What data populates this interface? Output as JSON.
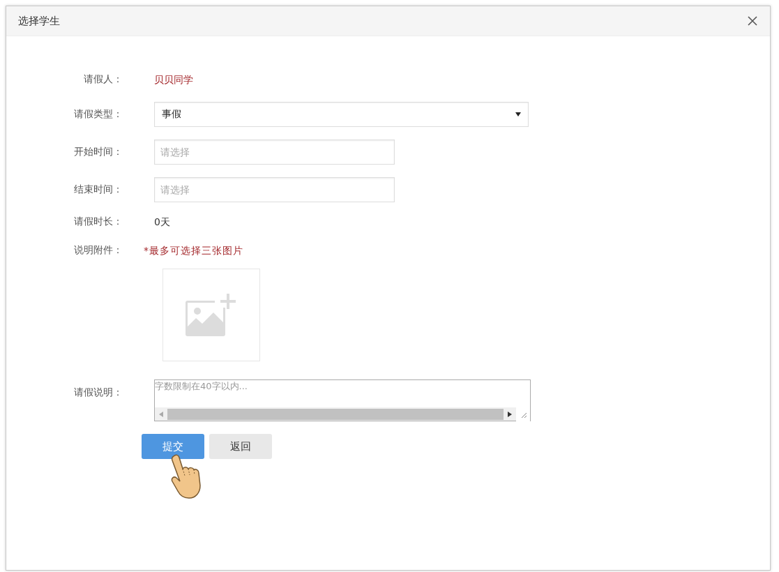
{
  "dialog": {
    "title": "选择学生"
  },
  "form": [
    {
      "kind": "text",
      "label": "请假人：",
      "value": "贝贝同学",
      "highlight": true
    },
    {
      "kind": "select",
      "label": "请假类型：",
      "value": "事假"
    },
    {
      "kind": "date",
      "label": "开始时间：",
      "placeholder": "请选择"
    },
    {
      "kind": "date",
      "label": "结束时间：",
      "placeholder": "请选择"
    },
    {
      "kind": "text",
      "label": "请假时长：",
      "value": "0天",
      "highlight": false
    },
    {
      "kind": "upload",
      "label": "说明附件：",
      "note": "*最多可选择三张图片"
    },
    {
      "kind": "textarea",
      "label": "请假说明：",
      "placeholder": "字数限制在40字以内..."
    }
  ],
  "buttons": [
    {
      "label": "提交",
      "kind": "primary"
    },
    {
      "label": "返回",
      "kind": "default"
    }
  ]
}
